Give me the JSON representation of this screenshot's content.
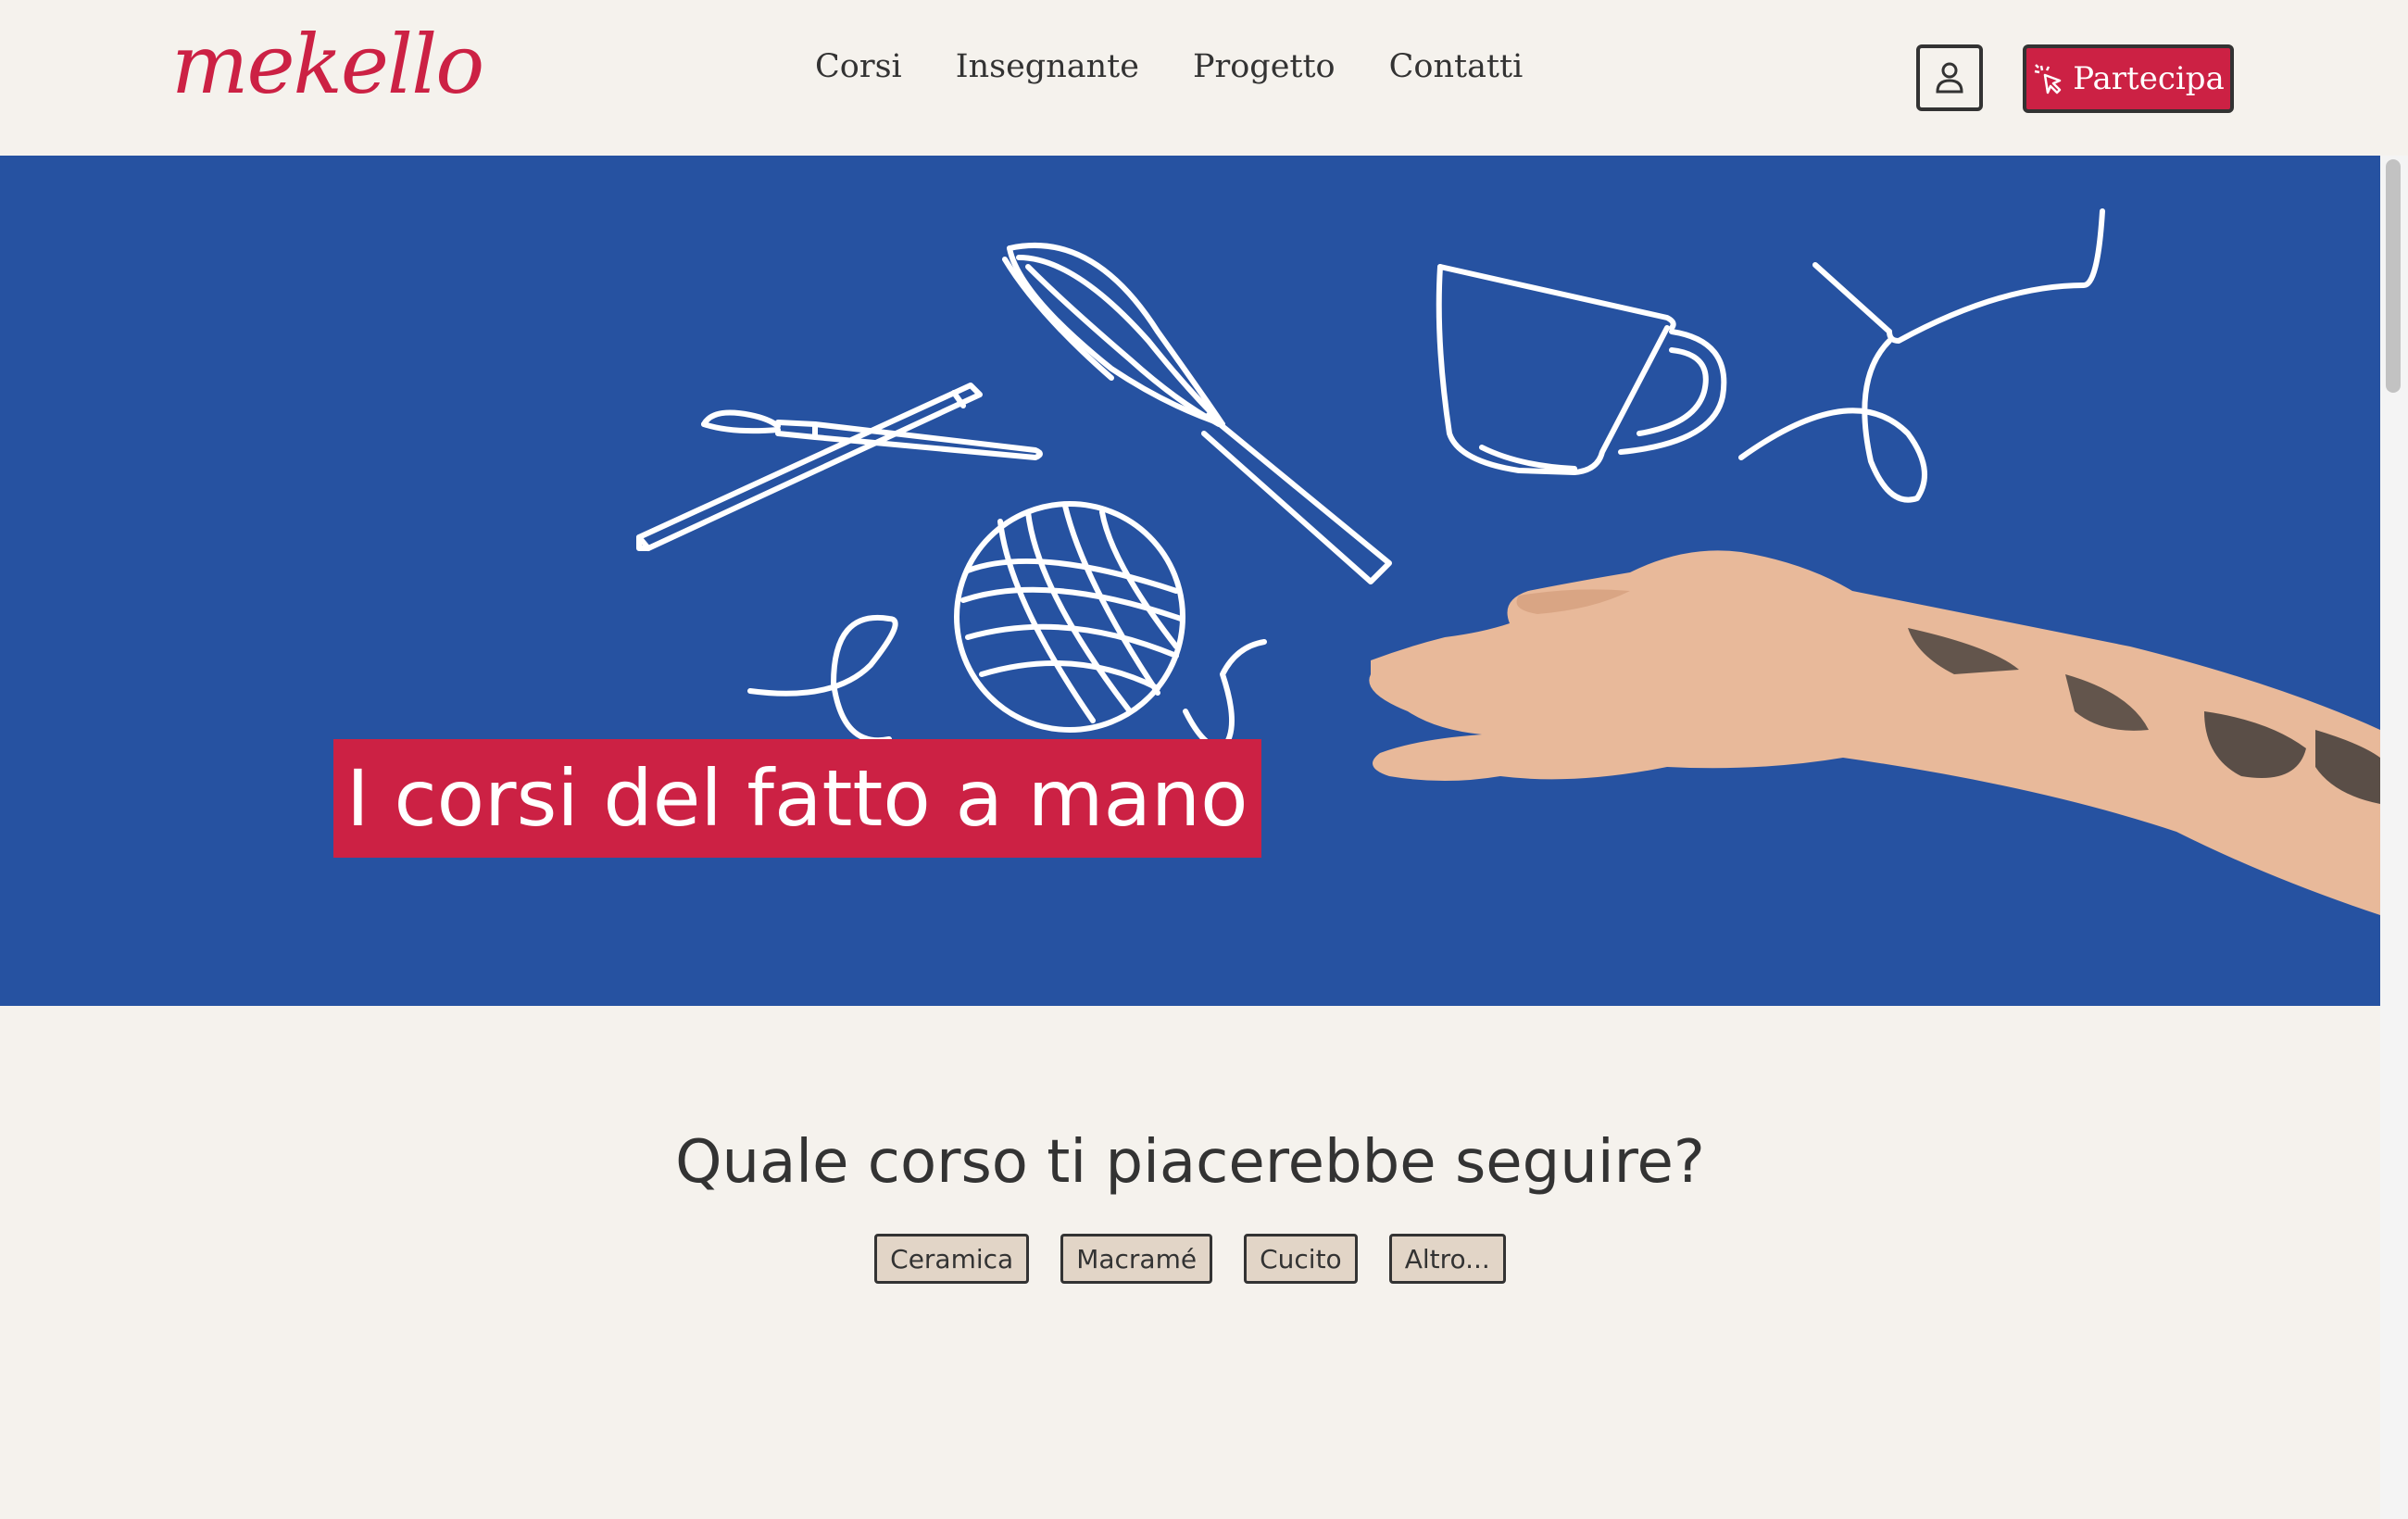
{
  "header": {
    "logo": "mekello",
    "nav": [
      "Corsi",
      "Insegnante",
      "Progetto",
      "Contatti"
    ],
    "join_label": "Partecipa"
  },
  "hero": {
    "title": "I corsi del fatto a mano",
    "colors": {
      "background": "#2652a1",
      "accent": "#cc2144"
    }
  },
  "section": {
    "question": "Quale corso ti piacerebbe seguire?",
    "chips": [
      "Ceramica",
      "Macramé",
      "Cucito",
      "Altro..."
    ]
  }
}
